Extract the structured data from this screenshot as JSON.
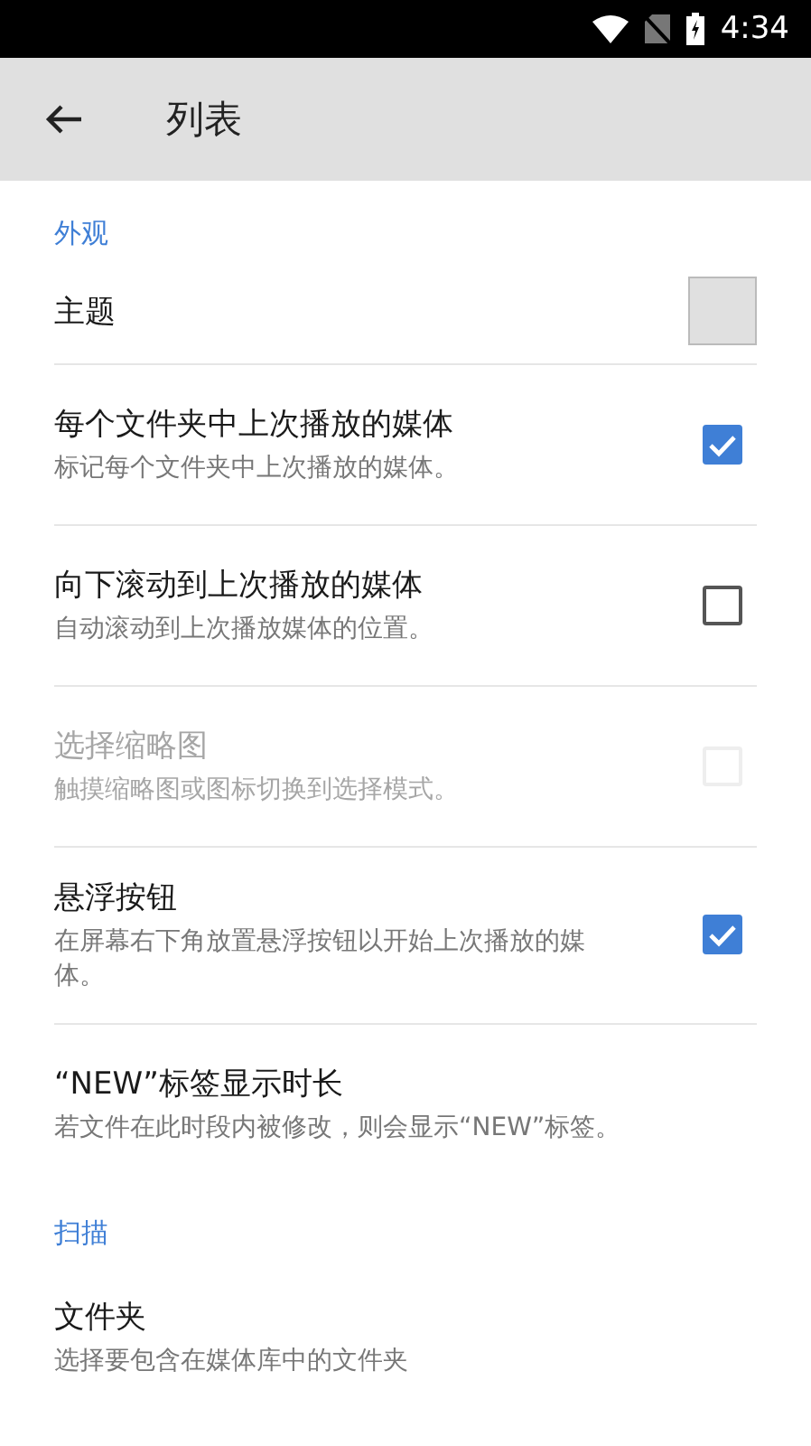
{
  "status_bar": {
    "time": "4:34"
  },
  "app_bar": {
    "title": "列表"
  },
  "sections": [
    {
      "title": "外观",
      "items": [
        {
          "kind": "color",
          "title": "主题",
          "color": "#e0e0e0",
          "disabled": false
        },
        {
          "kind": "checkbox",
          "title": "每个文件夹中上次播放的媒体",
          "subtitle": "标记每个文件夹中上次播放的媒体。",
          "checked": true,
          "disabled": false
        },
        {
          "kind": "checkbox",
          "title": "向下滚动到上次播放的媒体",
          "subtitle": "自动滚动到上次播放媒体的位置。",
          "checked": false,
          "disabled": false
        },
        {
          "kind": "checkbox",
          "title": "选择缩略图",
          "subtitle": "触摸缩略图或图标切换到选择模式。",
          "checked": false,
          "disabled": true
        },
        {
          "kind": "checkbox",
          "title": "悬浮按钮",
          "subtitle": "在屏幕右下角放置悬浮按钮以开始上次播放的媒体。",
          "checked": true,
          "disabled": false
        },
        {
          "kind": "text",
          "title": "“NEW”标签显示时长",
          "subtitle": "若文件在此时段内被修改，则会显示“NEW”标签。",
          "disabled": false
        }
      ]
    },
    {
      "title": "扫描",
      "items": [
        {
          "kind": "text",
          "title": "文件夹",
          "subtitle": "选择要包含在媒体库中的文件夹",
          "disabled": false
        }
      ]
    }
  ]
}
